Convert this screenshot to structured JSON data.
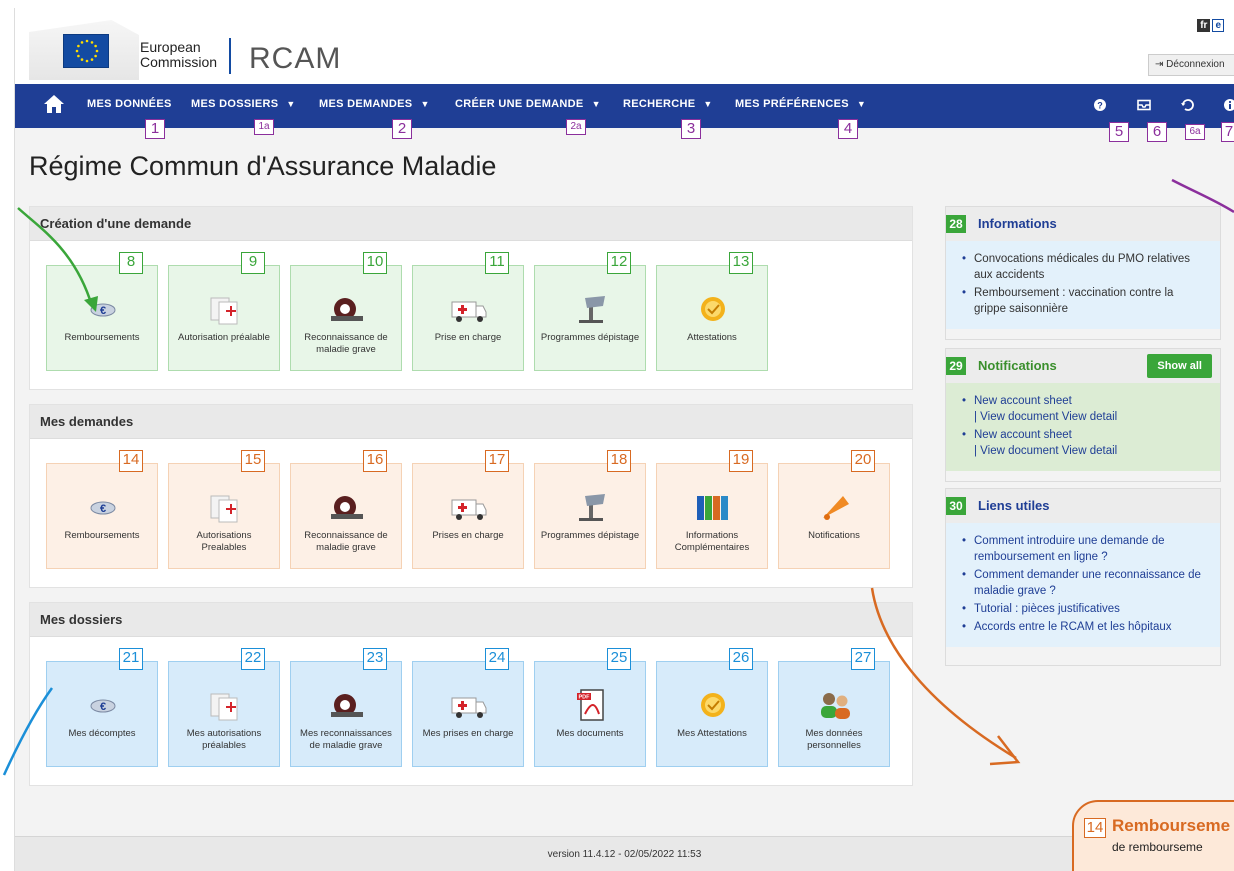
{
  "header": {
    "logo_line1": "European",
    "logo_line2": "Commission",
    "app_name": "RCAM",
    "lang_fr": "fr",
    "lang_en": "e",
    "logout_label": "Déconnexion"
  },
  "nav": {
    "items": [
      {
        "label": "MES DONNÉES",
        "callout": "1"
      },
      {
        "label": "MES DOSSIERS",
        "callout": "1a"
      },
      {
        "label": "MES DEMANDES",
        "callout": "2"
      },
      {
        "label": "CRÉER UNE DEMANDE",
        "callout": "2a"
      },
      {
        "label": "RECHERCHE",
        "callout": "3"
      },
      {
        "label": "MES PRÉFÉRENCES",
        "callout": "4"
      }
    ],
    "icon_callouts": [
      "5",
      "6",
      "6a",
      "7"
    ]
  },
  "page_title": "Régime Commun d'Assurance Maladie",
  "sections": {
    "creation": {
      "title": "Création d'une demande",
      "tiles": [
        {
          "num": "8",
          "label": "Remboursements",
          "icon": "euro-coin-icon"
        },
        {
          "num": "9",
          "label": "Autorisation préalable",
          "icon": "authorization-icon"
        },
        {
          "num": "10",
          "label": "Reconnaissance de maladie grave",
          "icon": "mri-scanner-icon"
        },
        {
          "num": "11",
          "label": "Prise en charge",
          "icon": "ambulance-icon"
        },
        {
          "num": "12",
          "label": "Programmes dépistage",
          "icon": "microscope-icon"
        },
        {
          "num": "13",
          "label": "Attestations",
          "icon": "certificate-icon"
        }
      ]
    },
    "demandes": {
      "title": "Mes demandes",
      "tiles": [
        {
          "num": "14",
          "label": "Remboursements",
          "icon": "euro-coin-icon"
        },
        {
          "num": "15",
          "label": "Autorisations Prealables",
          "icon": "authorization-icon"
        },
        {
          "num": "16",
          "label": "Reconnaissance de maladie grave",
          "icon": "mri-scanner-icon"
        },
        {
          "num": "17",
          "label": "Prises en charge",
          "icon": "ambulance-icon"
        },
        {
          "num": "18",
          "label": "Programmes dépistage",
          "icon": "microscope-icon"
        },
        {
          "num": "19",
          "label": "Informations Complémentaires",
          "icon": "binders-icon"
        },
        {
          "num": "20",
          "label": "Notifications",
          "icon": "bell-icon"
        }
      ]
    },
    "dossiers": {
      "title": "Mes dossiers",
      "tiles": [
        {
          "num": "21",
          "label": "Mes décomptes",
          "icon": "euro-coin-icon"
        },
        {
          "num": "22",
          "label": "Mes autorisations préalables",
          "icon": "authorization-icon"
        },
        {
          "num": "23",
          "label": "Mes reconnaissances de maladie grave",
          "icon": "mri-scanner-icon"
        },
        {
          "num": "24",
          "label": "Mes prises en charge",
          "icon": "ambulance-icon"
        },
        {
          "num": "25",
          "label": "Mes documents",
          "icon": "pdf-icon"
        },
        {
          "num": "26",
          "label": "Mes Attestations",
          "icon": "certificate-icon"
        },
        {
          "num": "27",
          "label": "Mes données personnelles",
          "icon": "people-icon"
        }
      ]
    }
  },
  "sidebar": {
    "informations": {
      "num": "28",
      "title": "Informations",
      "items": [
        "Convocations médicales du PMO relatives aux accidents",
        "Remboursement : vaccination contre la grippe saisonnière"
      ]
    },
    "notifications": {
      "num": "29",
      "title": "Notifications",
      "show_all": "Show all",
      "items": [
        {
          "title": "New account sheet",
          "links": "| View document View detail"
        },
        {
          "title": "New account sheet",
          "links": "| View document View detail"
        }
      ]
    },
    "liens": {
      "num": "30",
      "title": "Liens utiles",
      "items": [
        "Comment introduire une demande de remboursement en ligne ?",
        "Comment demander une reconnaissance de maladie grave ?",
        "Tutorial : pièces justificatives",
        "Accords entre le RCAM et les hôpitaux"
      ]
    }
  },
  "footer": {
    "version": "version 11.4.12 - 02/05/2022 11:53"
  },
  "callout_box": {
    "num": "14",
    "title": "Rembourseme",
    "subtitle": "de rembourseme"
  },
  "colors": {
    "nav": "#1f3e95",
    "green": "#3aa63a",
    "orange": "#d86a22",
    "blue": "#1b8fd8",
    "purple": "#8b2f9c"
  }
}
